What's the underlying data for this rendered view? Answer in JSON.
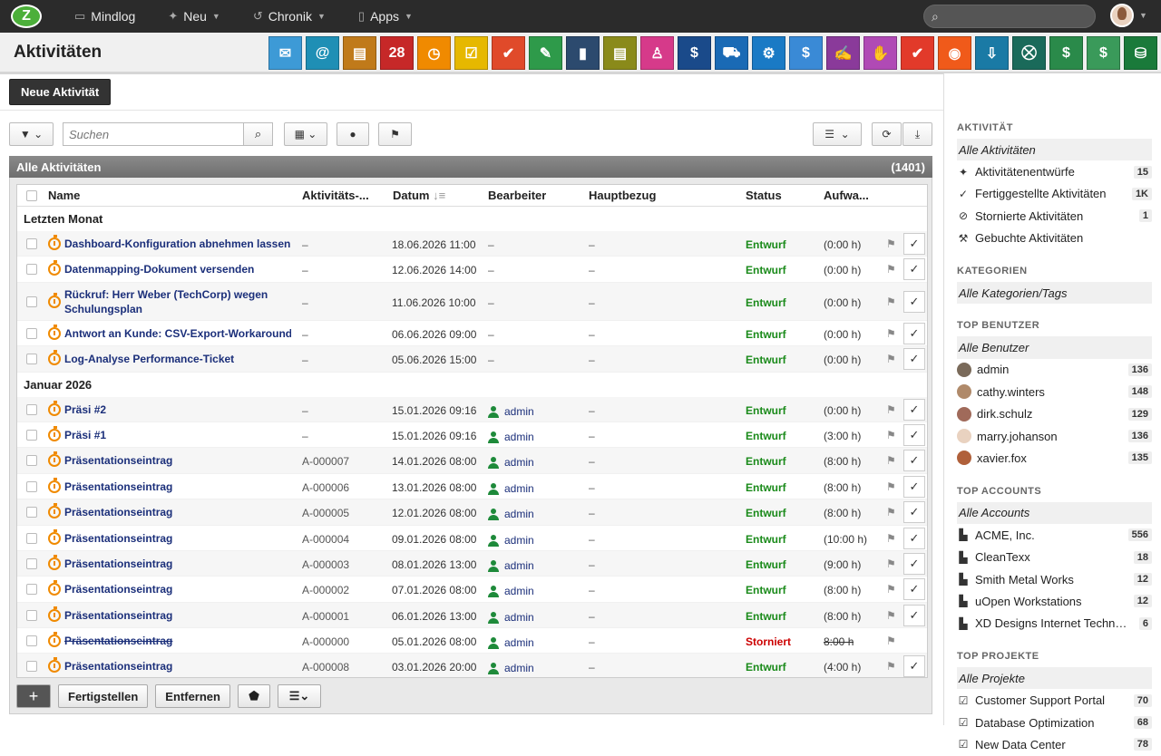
{
  "topnav": {
    "logo": "Z",
    "items": [
      {
        "label": "Mindlog",
        "icon": "monitor-icon"
      },
      {
        "label": "Neu",
        "icon": "sparkle-icon"
      },
      {
        "label": "Chronik",
        "icon": "history-icon"
      },
      {
        "label": "Apps",
        "icon": "tablet-icon"
      }
    ]
  },
  "page": {
    "title": "Aktivitäten",
    "new_button": "Neue Aktivität"
  },
  "modules": [
    {
      "icon": "mail-icon",
      "color": "#3d9ad6",
      "glyph": "✉"
    },
    {
      "icon": "email-contact-icon",
      "color": "#1f8fb5",
      "glyph": "@"
    },
    {
      "icon": "contacts-icon",
      "color": "#c07a1a",
      "glyph": "▤"
    },
    {
      "icon": "calendar-icon",
      "color": "#c62828",
      "glyph": "28"
    },
    {
      "icon": "stopwatch-icon",
      "color": "#f08a00",
      "glyph": "◷"
    },
    {
      "icon": "tasks-icon",
      "color": "#e6b800",
      "glyph": "☑"
    },
    {
      "icon": "folder-check-icon",
      "color": "#e04a2a",
      "glyph": "✔"
    },
    {
      "icon": "notes-icon",
      "color": "#2e9a4a",
      "glyph": "✎"
    },
    {
      "icon": "bookmark-icon",
      "color": "#2c4a6e",
      "glyph": "▮"
    },
    {
      "icon": "document-icon",
      "color": "#8a8a1a",
      "glyph": "▤"
    },
    {
      "icon": "reception-icon",
      "color": "#d63a8a",
      "glyph": "♙"
    },
    {
      "icon": "dollar-icon",
      "color": "#1a4a8a",
      "glyph": "$"
    },
    {
      "icon": "truck-icon",
      "color": "#1a6ab5",
      "glyph": "⛟"
    },
    {
      "icon": "support-icon",
      "color": "#1a7ac5",
      "glyph": "⚙"
    },
    {
      "icon": "moneybag-icon",
      "color": "#3a8ad6",
      "glyph": "$"
    },
    {
      "icon": "contract-icon",
      "color": "#8a3a9a",
      "glyph": "✍"
    },
    {
      "icon": "handshake-icon",
      "color": "#b04ab5",
      "glyph": "✋"
    },
    {
      "icon": "pdf-icon",
      "color": "#e23a2a",
      "glyph": "✔"
    },
    {
      "icon": "broadcast-icon",
      "color": "#f05a1a",
      "glyph": "◉"
    },
    {
      "icon": "download-box-icon",
      "color": "#1a7aa5",
      "glyph": "⇩"
    },
    {
      "icon": "cart-icon",
      "color": "#1a6a5a",
      "glyph": "⛒"
    },
    {
      "icon": "cash-icon",
      "color": "#2a8a4a",
      "glyph": "$"
    },
    {
      "icon": "price-tag-icon",
      "color": "#3a9a5a",
      "glyph": "$"
    },
    {
      "icon": "database-icon",
      "color": "#1a7a3a",
      "glyph": "⛁"
    }
  ],
  "toolbar": {
    "search_placeholder": "Suchen"
  },
  "panel": {
    "title": "Alle Aktivitäten",
    "count": "(1401)"
  },
  "columns": {
    "name": "Name",
    "number": "Aktivitäts-...",
    "date": "Datum",
    "owner": "Bearbeiter",
    "main_ref": "Hauptbezug",
    "status": "Status",
    "effort": "Aufwa..."
  },
  "groups": [
    {
      "label": "Letzten Monat",
      "rows": [
        {
          "name": "Dashboard-Konfiguration abnehmen lassen",
          "number": "–",
          "date": "18.06.2026 11:00",
          "owner": "–",
          "ref": "–",
          "status": "Entwurf",
          "effort": "(0:00 h)"
        },
        {
          "name": "Datenmapping-Dokument versenden",
          "number": "–",
          "date": "12.06.2026 14:00",
          "owner": "–",
          "ref": "–",
          "status": "Entwurf",
          "effort": "(0:00 h)"
        },
        {
          "name": "Rückruf: Herr Weber (TechCorp) wegen Schulungsplan",
          "number": "–",
          "date": "11.06.2026 10:00",
          "owner": "–",
          "ref": "–",
          "status": "Entwurf",
          "effort": "(0:00 h)",
          "tall": true
        },
        {
          "name": "Antwort an Kunde: CSV-Export-Workaround",
          "number": "–",
          "date": "06.06.2026 09:00",
          "owner": "–",
          "ref": "–",
          "status": "Entwurf",
          "effort": "(0:00 h)"
        },
        {
          "name": "Log-Analyse Performance-Ticket",
          "number": "–",
          "date": "05.06.2026 15:00",
          "owner": "–",
          "ref": "–",
          "status": "Entwurf",
          "effort": "(0:00 h)"
        }
      ]
    },
    {
      "label": "Januar 2026",
      "rows": [
        {
          "name": "Präsi #2",
          "number": "–",
          "date": "15.01.2026 09:16",
          "owner": "admin",
          "ref": "–",
          "status": "Entwurf",
          "effort": "(0:00 h)"
        },
        {
          "name": "Präsi #1",
          "number": "–",
          "date": "15.01.2026 09:16",
          "owner": "admin",
          "ref": "–",
          "status": "Entwurf",
          "effort": "(3:00 h)"
        },
        {
          "name": "Präsentationseintrag",
          "number": "A-000007",
          "date": "14.01.2026 08:00",
          "owner": "admin",
          "ref": "–",
          "status": "Entwurf",
          "effort": "(8:00 h)"
        },
        {
          "name": "Präsentationseintrag",
          "number": "A-000006",
          "date": "13.01.2026 08:00",
          "owner": "admin",
          "ref": "–",
          "status": "Entwurf",
          "effort": "(8:00 h)"
        },
        {
          "name": "Präsentationseintrag",
          "number": "A-000005",
          "date": "12.01.2026 08:00",
          "owner": "admin",
          "ref": "–",
          "status": "Entwurf",
          "effort": "(8:00 h)"
        },
        {
          "name": "Präsentationseintrag",
          "number": "A-000004",
          "date": "09.01.2026 08:00",
          "owner": "admin",
          "ref": "–",
          "status": "Entwurf",
          "effort": "(10:00 h)"
        },
        {
          "name": "Präsentationseintrag",
          "number": "A-000003",
          "date": "08.01.2026 13:00",
          "owner": "admin",
          "ref": "–",
          "status": "Entwurf",
          "effort": "(9:00 h)"
        },
        {
          "name": "Präsentationseintrag",
          "number": "A-000002",
          "date": "07.01.2026 08:00",
          "owner": "admin",
          "ref": "–",
          "status": "Entwurf",
          "effort": "(8:00 h)"
        },
        {
          "name": "Präsentationseintrag",
          "number": "A-000001",
          "date": "06.01.2026 13:00",
          "owner": "admin",
          "ref": "–",
          "status": "Entwurf",
          "effort": "(8:00 h)"
        },
        {
          "name": "Präsentationseintrag",
          "number": "A-000000",
          "date": "05.01.2026 08:00",
          "owner": "admin",
          "ref": "–",
          "status": "Storniert",
          "effort": "8:00 h",
          "cancelled": true
        },
        {
          "name": "Präsentationseintrag",
          "number": "A-000008",
          "date": "03.01.2026 20:00",
          "owner": "admin",
          "ref": "–",
          "status": "Entwurf",
          "effort": "(4:00 h)"
        }
      ]
    }
  ],
  "bottom": {
    "add": "+",
    "finish": "Fertigstellen",
    "remove": "Entfernen"
  },
  "sidebar": {
    "activity_title": "AKTIVITÄT",
    "activity_all": "Alle Aktivitäten",
    "activity_items": [
      {
        "label": "Aktivitätenentwürfe",
        "count": "15",
        "icon": "sparkle-icon",
        "glyph": "✦"
      },
      {
        "label": "Fertiggestellte Aktivitäten",
        "count": "1K",
        "icon": "double-check-icon",
        "glyph": "✓"
      },
      {
        "label": "Stornierte Aktivitäten",
        "count": "1",
        "icon": "ban-icon",
        "glyph": "⊘"
      },
      {
        "label": "Gebuchte Aktivitäten",
        "count": "",
        "icon": "hammer-icon",
        "glyph": "⚒"
      }
    ],
    "categories_title": "KATEGORIEN",
    "categories_all": "Alle Kategorien/Tags",
    "users_title": "TOP BENUTZER",
    "users_all": "Alle Benutzer",
    "users": [
      {
        "label": "admin",
        "count": "136",
        "color": "#7a6a5a"
      },
      {
        "label": "cathy.winters",
        "count": "148",
        "color": "#b08a6a"
      },
      {
        "label": "dirk.schulz",
        "count": "129",
        "color": "#a06a5a"
      },
      {
        "label": "marry.johanson",
        "count": "136",
        "color": "#e9d2c0"
      },
      {
        "label": "xavier.fox",
        "count": "135",
        "color": "#b0603a"
      }
    ],
    "accounts_title": "TOP ACCOUNTS",
    "accounts_all": "Alle Accounts",
    "accounts": [
      {
        "label": "ACME, Inc.",
        "count": "556"
      },
      {
        "label": "CleanTexx",
        "count": "18"
      },
      {
        "label": "Smith Metal Works",
        "count": "12"
      },
      {
        "label": "uOpen Workstations",
        "count": "12"
      },
      {
        "label": "XD Designs Internet Technol...",
        "count": "6"
      }
    ],
    "projects_title": "TOP PROJEKTE",
    "projects_all": "Alle Projekte",
    "projects": [
      {
        "label": "Customer Support Portal",
        "count": "70"
      },
      {
        "label": "Database Optimization",
        "count": "68"
      },
      {
        "label": "New Data Center",
        "count": "78"
      }
    ]
  }
}
